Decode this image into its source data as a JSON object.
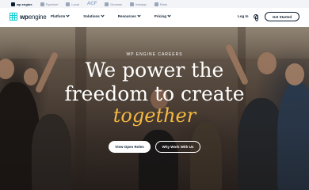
{
  "brand_bar": {
    "brands": [
      {
        "name": "wp engine",
        "active": true
      },
      {
        "name": "Flywheel",
        "active": false
      },
      {
        "name": "Local",
        "active": false
      },
      {
        "name": "ACF",
        "active": false
      },
      {
        "name": "Genesis",
        "active": false
      },
      {
        "name": "Instawp",
        "active": false
      },
      {
        "name": "Rank",
        "active": false
      }
    ]
  },
  "nav": {
    "logo_wp": "wp",
    "logo_engine": "engine",
    "items": [
      {
        "label": "Platform"
      },
      {
        "label": "Solutions"
      },
      {
        "label": "Resources"
      },
      {
        "label": "Pricing"
      }
    ],
    "login": "Log In",
    "cta": "Get Started",
    "icons": {
      "globe": "globe-icon",
      "chevron": "chevron-down-icon"
    }
  },
  "hero": {
    "eyebrow": "WP ENGINE CAREERS",
    "headline_line1": "We power the",
    "headline_line2": "freedom to create",
    "accent": "together",
    "accent_color": "#f4b942",
    "primary_button": "View Open Roles",
    "secondary_button": "Why Work With Us"
  },
  "colors": {
    "navy": "#0b1f33",
    "brand_teal": "#0ecad4"
  }
}
